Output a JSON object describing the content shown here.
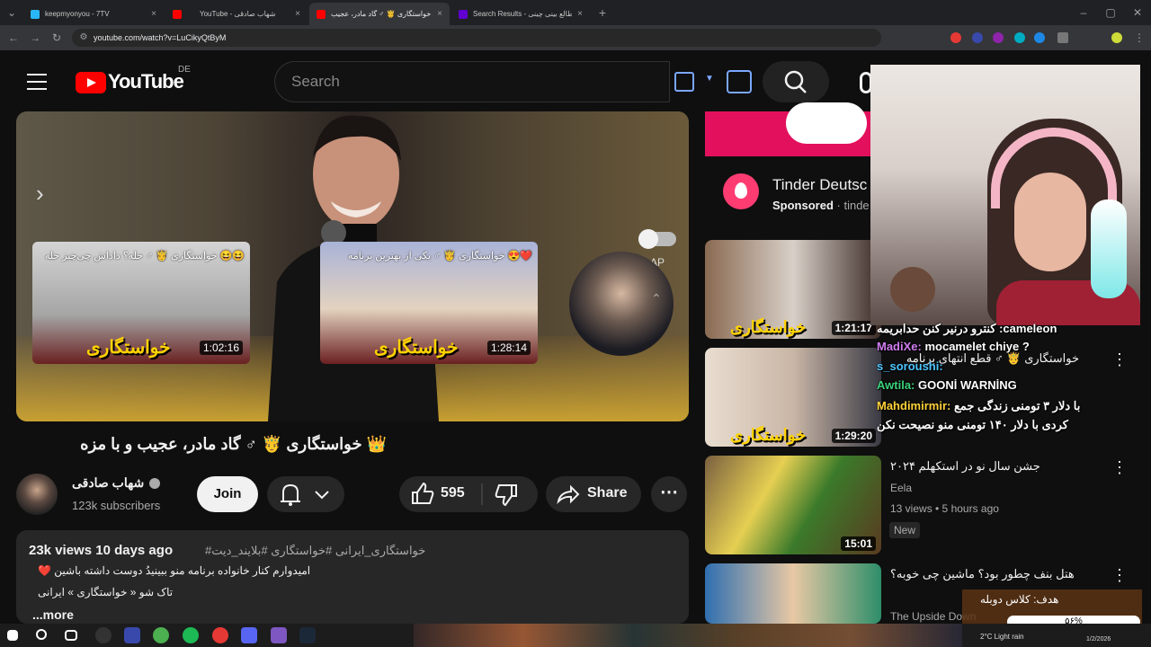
{
  "browser": {
    "tabs": [
      {
        "title": "keepmyonyou - 7TV",
        "color": "#29b6f6",
        "active": false
      },
      {
        "title": "",
        "color": "#ff0000",
        "active": false
      },
      {
        "title": "YouTube - شهاب صادقی",
        "color": "#ff0000",
        "active": false
      },
      {
        "title": "خواستگاری 🤴 ♂ گاد مادر، عجیب",
        "color": "#ff0000",
        "active": true
      },
      {
        "title": "Search Results - طالع بینی چینی",
        "color": "#6001d2",
        "active": false
      }
    ],
    "tab_close": "×",
    "new_tab": "+",
    "url": "youtube.com/watch?v=LuCikyQtByM",
    "window_buttons": [
      "–",
      "▢",
      "✕"
    ]
  },
  "youtube": {
    "logo_text": "YouTube",
    "country": "DE",
    "search_placeholder": "Search",
    "player": {
      "cards": [
        {
          "title": "خواستگاری 🤴 ♂ حله؟ داداش چی‌چیز حله 😆😆",
          "duration": "1:02:16",
          "label": "خواستگاری"
        },
        {
          "title": "خواستگاری 🤴 ♂ یکی از بهترین برنامه 😍❤️",
          "duration": "1:28:14",
          "label": "خواستگاری"
        }
      ],
      "ap_label": "AP"
    },
    "video_title": "👑 خواستگاری 🤴 ♂ گاد مادر، عجیب و با مزه",
    "channel": {
      "name": "شهاب صادقی",
      "subscribers": "123k subscribers",
      "join_label": "Join"
    },
    "actions": {
      "likes": "595",
      "share_label": "Share",
      "more_label": "⋯"
    },
    "description": {
      "meta": "23k views  10 days ago",
      "tags": "#خواستگاری_ایرانی #خواستگاری #بلایند_دیت",
      "lines": [
        "امیدوارم کنار خانواده برنامه منو ببینیدُ دوست داشته باشین ❤️",
        "تاک شو « خواستگاری » ایرانی"
      ],
      "more": "...more"
    },
    "sidebar": {
      "ad": {
        "name": "Tinder Deutsc",
        "sponsored": "Sponsored",
        "domain": "· tinde"
      },
      "videos": [
        {
          "duration": "1:21:17",
          "label": "خواستگاری",
          "title": "",
          "channel": "",
          "meta": ""
        },
        {
          "duration": "1:29:20",
          "label": "خواستگاری",
          "title": "خواستگاری 🤴 ♂ قطع انتهای برنامه",
          "channel": "",
          "meta": "",
          "badge": ""
        },
        {
          "duration": "15:01",
          "title": "جشن سال نو در استکهلم ۲۰۲۴",
          "channel": "Eela",
          "meta": "13 views • 5 hours ago",
          "badge": "New"
        },
        {
          "duration": "",
          "title": "هتل بنف چطور بود؟ ماشین چی خوبه؟",
          "channel": "The Upside Down",
          "meta": ""
        }
      ]
    }
  },
  "stream_overlay": {
    "chat": [
      {
        "user": "",
        "text": "کنترو درنیر کنن حدابریمه :cameleon"
      },
      {
        "user": "MadiXe:",
        "text": "mocamelet chiye ?"
      },
      {
        "user": "s_soroushi:",
        "text": ""
      },
      {
        "user": "Awtila:",
        "text": "GOONİ WARNİNG"
      },
      {
        "user": "Mahdimirmir:",
        "text": "با دلار ۳ تومنی زندگی جمع"
      },
      {
        "user": "",
        "text": "کردی با دلار ۱۴۰ تومنی منو نصیحت نکن"
      }
    ],
    "goal_title": "هدف: کلاس دوبله",
    "goal_percent": "۵۶%",
    "goal_fraction": 0.56
  },
  "taskbar": {
    "weather": "2°C  Light rain",
    "date": "1/2/2026"
  }
}
